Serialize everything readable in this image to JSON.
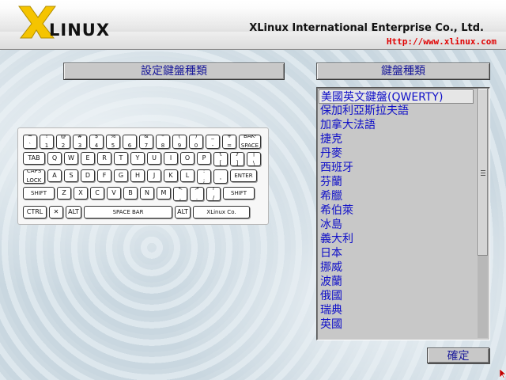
{
  "header": {
    "logo_text": "LINUX",
    "logo_letter": "X",
    "company": "XLinux International Enterprise Co., Ltd.",
    "url": "Http://www.xlinux.com"
  },
  "left_panel": {
    "title": "設定鍵盤種類"
  },
  "right_panel": {
    "title": "鍵盤種類"
  },
  "keyboard": {
    "row1": [
      {
        "top": "~",
        "bottom": "`"
      },
      {
        "top": "!",
        "bottom": "1"
      },
      {
        "top": "@",
        "bottom": "2"
      },
      {
        "top": "#",
        "bottom": "3"
      },
      {
        "top": "$",
        "bottom": "4"
      },
      {
        "top": "%",
        "bottom": "5"
      },
      {
        "top": "^",
        "bottom": "6"
      },
      {
        "top": "&",
        "bottom": "7"
      },
      {
        "top": "*",
        "bottom": "8"
      },
      {
        "top": "(",
        "bottom": "9"
      },
      {
        "top": ")",
        "bottom": "0"
      },
      {
        "top": "_",
        "bottom": "-"
      },
      {
        "top": "+",
        "bottom": "="
      },
      {
        "top": "BAK-",
        "bottom": "SPACE"
      }
    ],
    "row2": [
      {
        "label": "TAB"
      },
      {
        "label": "Q"
      },
      {
        "label": "W"
      },
      {
        "label": "E"
      },
      {
        "label": "R"
      },
      {
        "label": "T"
      },
      {
        "label": "Y"
      },
      {
        "label": "U"
      },
      {
        "label": "I"
      },
      {
        "label": "O"
      },
      {
        "label": "P"
      },
      {
        "top": "{",
        "bottom": "["
      },
      {
        "top": "}",
        "bottom": "]"
      },
      {
        "top": "|",
        "bottom": "\\"
      }
    ],
    "row3": [
      {
        "top": "CAPS",
        "bottom": "LOCK"
      },
      {
        "label": "A"
      },
      {
        "label": "S"
      },
      {
        "label": "D"
      },
      {
        "label": "F"
      },
      {
        "label": "G"
      },
      {
        "label": "H"
      },
      {
        "label": "J"
      },
      {
        "label": "K"
      },
      {
        "label": "L"
      },
      {
        "top": ":",
        "bottom": ";"
      },
      {
        "top": "\"",
        "bottom": "'"
      },
      {
        "label": "ENTER"
      }
    ],
    "row4": [
      {
        "label": "SHIFT"
      },
      {
        "label": "Z"
      },
      {
        "label": "X"
      },
      {
        "label": "C"
      },
      {
        "label": "V"
      },
      {
        "label": "B"
      },
      {
        "label": "N"
      },
      {
        "label": "M"
      },
      {
        "top": "<",
        "bottom": ","
      },
      {
        "top": ">",
        "bottom": "."
      },
      {
        "top": "?",
        "bottom": "/"
      },
      {
        "label": "SHIFT"
      }
    ],
    "row5": [
      {
        "label": "CTRL"
      },
      {
        "label": "✕"
      },
      {
        "label": "ALT"
      },
      {
        "label": "SPACE BAR"
      },
      {
        "label": "ALT"
      },
      {
        "label": "XLinux Co."
      }
    ]
  },
  "keyboard_types": [
    "美國英文鍵盤(QWERTY)",
    "保加利亞斯拉夫語",
    "加拿大法語",
    "捷克",
    "丹麥",
    "西班牙",
    "芬蘭",
    "希臘",
    "希伯萊",
    "冰島",
    "義大利",
    "日本",
    "挪威",
    "波蘭",
    "俄國",
    "瑞典",
    "英國"
  ],
  "selected_index": 0,
  "ok_button": "確定",
  "colors": {
    "title_text": "#1a1a9a",
    "list_text": "#1010c8",
    "url": "#e00000"
  }
}
